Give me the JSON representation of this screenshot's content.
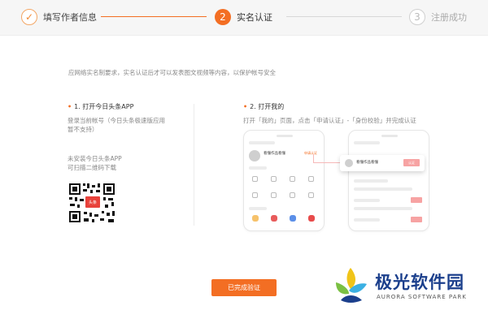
{
  "stepper": {
    "steps": [
      {
        "number": "✓",
        "label": "填写作者信息",
        "state": "done"
      },
      {
        "number": "2",
        "label": "实名认证",
        "state": "active"
      },
      {
        "number": "3",
        "label": "注册成功",
        "state": "pending"
      }
    ],
    "accent_color": "#f36e23"
  },
  "intro_text": "应网络实名制要求，实名认证后才可以发表图文视频等内容，以保护帐号安全",
  "left": {
    "title": "1. 打开今日头条APP",
    "description": "登录当前帐号（今日头条极速版应用暂不支持）",
    "no_app_line1": "未安装今日头条APP",
    "no_app_line2": "可扫描二维码下载",
    "qr_badge": "头条"
  },
  "right": {
    "title": "2. 打开我的",
    "description": "打开「我的」页面，点击「申请认证」-「身份校验」并完成认证",
    "phone1": {
      "name": "看懂作品看懂",
      "apply": "申请认证"
    },
    "popup": {
      "name": "看懂作品看懂",
      "button": "认证"
    }
  },
  "verify_button": "已完成验证",
  "watermark": {
    "cn": "极光软件园",
    "en": "AURORA SOFTWARE PARK"
  }
}
